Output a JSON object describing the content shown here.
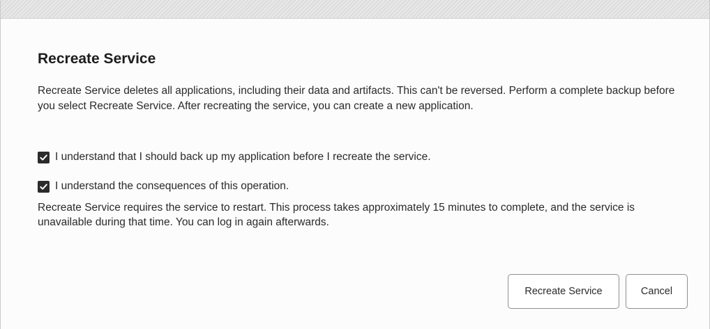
{
  "dialog": {
    "title": "Recreate Service",
    "description": "Recreate Service deletes all applications, including their data and artifacts. This can't be reversed. Perform a complete backup before you select Recreate Service. After recreating the service, you can create a new application.",
    "checkboxes": [
      {
        "label": "I understand that I should back up my application before I recreate the service.",
        "checked": true
      },
      {
        "label": "I understand the consequences of this operation.",
        "checked": true
      }
    ],
    "note": "Recreate Service requires the service to restart. This process takes approximately 15 minutes to complete, and the service is unavailable during that time. You can log in again afterwards.",
    "buttons": {
      "recreate_label": "Recreate Service",
      "cancel_label": "Cancel"
    }
  },
  "icons": {
    "checkbox_check": "checkmark-icon"
  },
  "colors": {
    "checkbox_fill": "#2b2b2b",
    "text": "#2a2a2a",
    "button_border": "#8f8f8f"
  }
}
